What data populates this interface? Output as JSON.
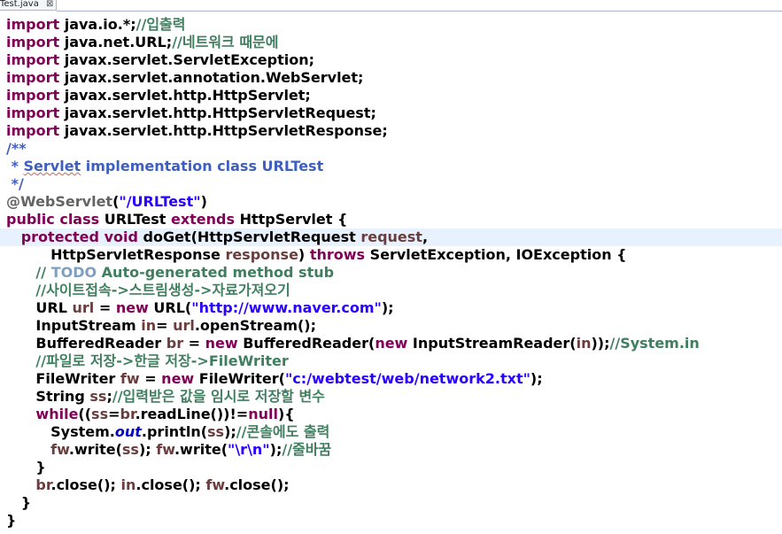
{
  "tab": {
    "title": "Test.java",
    "close_glyph": "⊠"
  },
  "code": {
    "lines": [
      [
        {
          "t": "import ",
          "c": "kw"
        },
        {
          "t": "java.io.*;"
        },
        {
          "t": "//입출력",
          "c": "cm"
        }
      ],
      [
        {
          "t": "import ",
          "c": "kw"
        },
        {
          "t": "java.net.URL;"
        },
        {
          "t": "//네트워크 때문에",
          "c": "cm"
        }
      ],
      [
        {
          "t": "import ",
          "c": "kw"
        },
        {
          "t": "javax.servlet.ServletException;"
        }
      ],
      [
        {
          "t": "import ",
          "c": "kw"
        },
        {
          "t": "javax.servlet.annotation.WebServlet;"
        }
      ],
      [
        {
          "t": "import ",
          "c": "kw"
        },
        {
          "t": "javax.servlet.http.HttpServlet;"
        }
      ],
      [
        {
          "t": "import ",
          "c": "kw"
        },
        {
          "t": "javax.servlet.http.HttpServletRequest;"
        }
      ],
      [
        {
          "t": "import ",
          "c": "kw"
        },
        {
          "t": "javax.servlet.http.HttpServletResponse;"
        }
      ],
      [
        {
          "t": "/**",
          "c": "jd"
        }
      ],
      [
        {
          "t": " * ",
          "c": "jd"
        },
        {
          "t": "Servlet",
          "c": "jd squiggle"
        },
        {
          "t": " implementation class URLTest",
          "c": "jd"
        }
      ],
      [
        {
          "t": " */",
          "c": "jd"
        }
      ],
      [
        {
          "t": "@WebServlet",
          "c": "ann"
        },
        {
          "t": "("
        },
        {
          "t": "\"/URLTest\"",
          "c": "str"
        },
        {
          "t": ")"
        }
      ],
      [
        {
          "t": "public ",
          "c": "kw"
        },
        {
          "t": "class ",
          "c": "kw"
        },
        {
          "t": "URLTest "
        },
        {
          "t": "extends ",
          "c": "kw"
        },
        {
          "t": "HttpServlet {"
        }
      ],
      [
        {
          "t": "   protected ",
          "c": "kw"
        },
        {
          "t": "void ",
          "c": "kw"
        },
        {
          "t": "doGet(HttpServletRequest "
        },
        {
          "t": "request",
          "c": "var"
        },
        {
          "t": ","
        }
      ],
      [
        {
          "t": "         HttpServletResponse "
        },
        {
          "t": "response",
          "c": "var"
        },
        {
          "t": ") "
        },
        {
          "t": "throws ",
          "c": "kw"
        },
        {
          "t": "ServletException, IOException {"
        }
      ],
      [
        {
          "t": "      "
        },
        {
          "t": "// ",
          "c": "cm"
        },
        {
          "t": "TODO",
          "c": "todo"
        },
        {
          "t": " Auto-generated method stub",
          "c": "cm"
        }
      ],
      [
        {
          "t": "      "
        },
        {
          "t": "//사이트접속->스트림생성->자료가져오기",
          "c": "cm"
        }
      ],
      [
        {
          "t": "      URL "
        },
        {
          "t": "url",
          "c": "var"
        },
        {
          "t": " = "
        },
        {
          "t": "new ",
          "c": "kw"
        },
        {
          "t": "URL("
        },
        {
          "t": "\"http://www.naver.com\"",
          "c": "str"
        },
        {
          "t": ");"
        }
      ],
      [
        {
          "t": "      InputStream "
        },
        {
          "t": "in",
          "c": "var"
        },
        {
          "t": "= "
        },
        {
          "t": "url",
          "c": "var"
        },
        {
          "t": ".openStream();"
        }
      ],
      [
        {
          "t": "      BufferedReader "
        },
        {
          "t": "br",
          "c": "var"
        },
        {
          "t": " = "
        },
        {
          "t": "new ",
          "c": "kw"
        },
        {
          "t": "BufferedReader("
        },
        {
          "t": "new ",
          "c": "kw"
        },
        {
          "t": "InputStreamReader("
        },
        {
          "t": "in",
          "c": "var"
        },
        {
          "t": "));"
        },
        {
          "t": "//System.in",
          "c": "cm"
        }
      ],
      [
        {
          "t": "      "
        },
        {
          "t": "//파일로 저장->한글 저장->FileWriter",
          "c": "cm"
        }
      ],
      [
        {
          "t": "      FileWriter "
        },
        {
          "t": "fw",
          "c": "var"
        },
        {
          "t": " = "
        },
        {
          "t": "new ",
          "c": "kw"
        },
        {
          "t": "FileWriter("
        },
        {
          "t": "\"c:/webtest/web/network2.txt\"",
          "c": "str"
        },
        {
          "t": ");"
        }
      ],
      [
        {
          "t": "      String "
        },
        {
          "t": "ss",
          "c": "var"
        },
        {
          "t": ";"
        },
        {
          "t": "//입력받은 값을 임시로 저장할 변수",
          "c": "cm"
        }
      ],
      [
        {
          "t": "      "
        },
        {
          "t": "while",
          "c": "kw"
        },
        {
          "t": "(("
        },
        {
          "t": "ss",
          "c": "var"
        },
        {
          "t": "="
        },
        {
          "t": "br",
          "c": "var"
        },
        {
          "t": ".readLine())!="
        },
        {
          "t": "null",
          "c": "kw"
        },
        {
          "t": "){"
        }
      ],
      [
        {
          "t": "         System."
        },
        {
          "t": "out",
          "c": "fld it"
        },
        {
          "t": ".println("
        },
        {
          "t": "ss",
          "c": "var"
        },
        {
          "t": ");"
        },
        {
          "t": "//콘솔에도 출력",
          "c": "cm"
        }
      ],
      [
        {
          "t": "         "
        },
        {
          "t": "fw",
          "c": "var"
        },
        {
          "t": ".write("
        },
        {
          "t": "ss",
          "c": "var"
        },
        {
          "t": "); "
        },
        {
          "t": "fw",
          "c": "var"
        },
        {
          "t": ".write("
        },
        {
          "t": "\"\\r\\n\"",
          "c": "str"
        },
        {
          "t": ");"
        },
        {
          "t": "//줄바꿈",
          "c": "cm"
        }
      ],
      [
        {
          "t": "      }"
        }
      ],
      [
        {
          "t": "      "
        },
        {
          "t": "br",
          "c": "var"
        },
        {
          "t": ".close(); "
        },
        {
          "t": "in",
          "c": "var"
        },
        {
          "t": ".close(); "
        },
        {
          "t": "fw",
          "c": "var"
        },
        {
          "t": ".close();"
        }
      ],
      [
        {
          "t": "   }"
        }
      ],
      [
        {
          "t": "}"
        }
      ]
    ]
  }
}
